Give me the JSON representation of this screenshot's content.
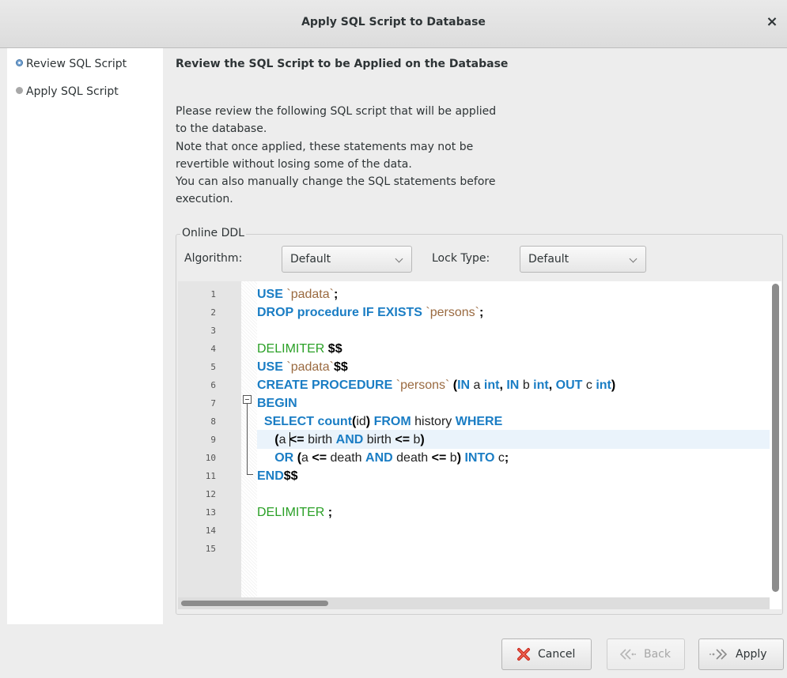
{
  "window": {
    "title": "Apply SQL Script to Database",
    "close_glyph": "×"
  },
  "sidebar": {
    "steps": [
      {
        "label": "Review SQL Script",
        "state": "current"
      },
      {
        "label": "Apply SQL Script",
        "state": "pending"
      }
    ]
  },
  "main": {
    "heading": "Review the SQL Script to be Applied on the Database",
    "description": [
      "Please review the following SQL script that will be applied",
      "to the database.",
      "Note that once applied, these statements may not be",
      "revertible without losing some of the data.",
      "You can also manually change the SQL statements before",
      "execution."
    ]
  },
  "online_ddl": {
    "group_label": "Online DDL",
    "algorithm_label": "Algorithm:",
    "algorithm_value": "Default",
    "lock_type_label": "Lock Type:",
    "lock_type_value": "Default"
  },
  "editor": {
    "line_numbers": [
      "1",
      "2",
      "3",
      "4",
      "5",
      "6",
      "7",
      "8",
      "9",
      "10",
      "11",
      "12",
      "13",
      "14",
      "15"
    ],
    "lines": [
      "USE `padata`;",
      "DROP procedure IF EXISTS `persons`;",
      "",
      "DELIMITER $$",
      "USE `padata`$$",
      "CREATE PROCEDURE `persons` (IN a int, IN b int, OUT c int)",
      "BEGIN",
      "  SELECT count(id) FROM history WHERE",
      "     (a <= birth AND birth <= b)",
      "     OR (a <= death AND death <= b) INTO c;",
      "END$$",
      "",
      "DELIMITER ;",
      "",
      ""
    ],
    "highlighted_line": 9,
    "colors": {
      "keyword": "#1a7dc4",
      "string": "#9a6a40",
      "delimiter": "#2aa026"
    }
  },
  "buttons": {
    "cancel": {
      "label": "Cancel",
      "icon": "cancel-x-icon"
    },
    "back": {
      "label": "Back",
      "icon": "back-arrow-icon",
      "enabled": false
    },
    "apply": {
      "label": "Apply",
      "icon": "apply-arrow-icon"
    }
  }
}
